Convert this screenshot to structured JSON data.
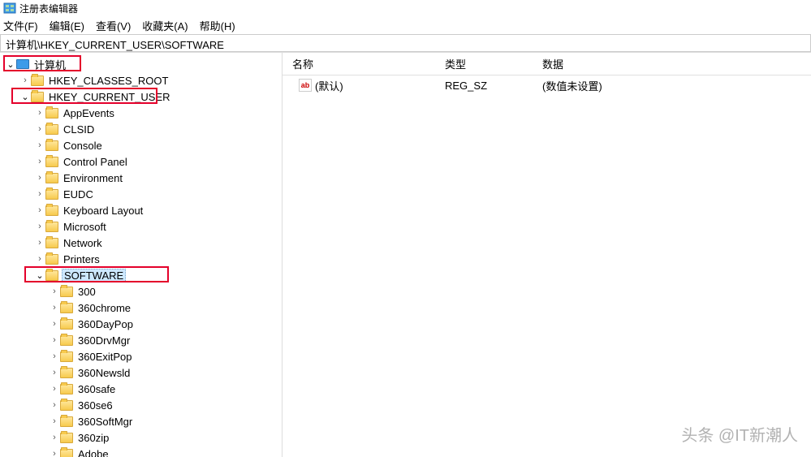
{
  "title": "注册表编辑器",
  "menu": {
    "file": "文件(F)",
    "edit": "编辑(E)",
    "view": "查看(V)",
    "favorites": "收藏夹(A)",
    "help": "帮助(H)"
  },
  "address": "计算机\\HKEY_CURRENT_USER\\SOFTWARE",
  "columns": {
    "name": "名称",
    "type": "类型",
    "data": "数据"
  },
  "value_row": {
    "name": "(默认)",
    "type": "REG_SZ",
    "data": "(数值未设置)"
  },
  "tree": {
    "root": "计算机",
    "hkcr": "HKEY_CLASSES_ROOT",
    "hkcu": {
      "label": "HKEY_CURRENT_USER",
      "children": [
        "AppEvents",
        "CLSID",
        "Console",
        "Control Panel",
        "Environment",
        "EUDC",
        "Keyboard Layout",
        "Microsoft",
        "Network",
        "Printers"
      ],
      "software": {
        "label": "SOFTWARE",
        "children": [
          "300",
          "360chrome",
          "360DayPop",
          "360DrvMgr",
          "360ExitPop",
          "360Newsld",
          "360safe",
          "360se6",
          "360SoftMgr",
          "360zip",
          "Adobe"
        ]
      }
    }
  },
  "watermark": "头条 @IT新潮人"
}
